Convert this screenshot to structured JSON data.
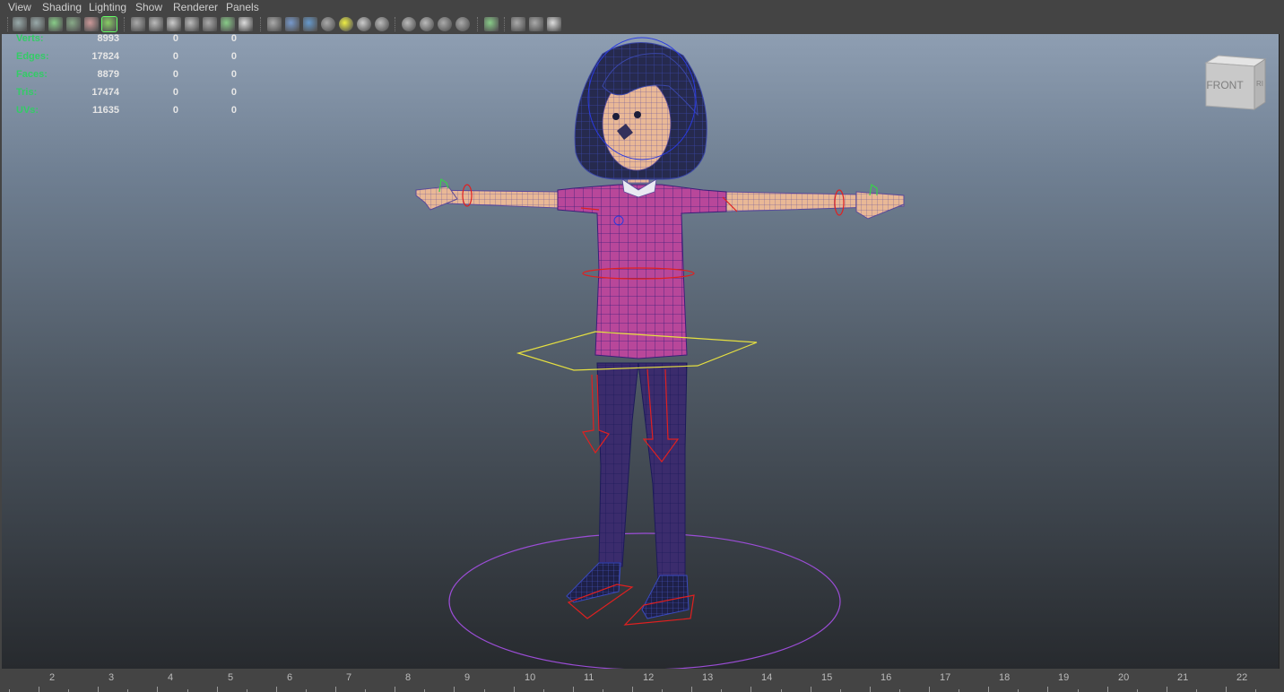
{
  "menu": [
    "View",
    "Shading",
    "Lighting",
    "Show",
    "Renderer",
    "Panels"
  ],
  "toolbar_icons": [
    "select-camera-icon",
    "camera-attributes-icon",
    "bookmarks-icon",
    "image-plane-icon",
    "2d-pan-zoom-icon",
    "grease-pencil-icon",
    "frame-all-icon",
    "grid-icon",
    "film-gate-icon",
    "resolution-gate-icon",
    "gate-mask-icon",
    "field-chart-icon",
    "safe-action-icon",
    "safe-title-icon",
    "wireframe-icon",
    "smooth-shade-icon",
    "wireframe-on-shaded-icon",
    "textured-icon",
    "use-all-lights-icon",
    "shadows-icon",
    "screen-space-ao-icon",
    "motion-blur-icon",
    "multisample-aa-icon",
    "depth-of-field-icon",
    "isolate-select-icon",
    "xray-icon",
    "xray-active-components-icon",
    "xray-joints-icon"
  ],
  "hud": {
    "rows": [
      {
        "label": "Verts:",
        "v1": "8993",
        "v2": "0",
        "v3": "0"
      },
      {
        "label": "Edges:",
        "v1": "17824",
        "v2": "0",
        "v3": "0"
      },
      {
        "label": "Faces:",
        "v1": "8879",
        "v2": "0",
        "v3": "0"
      },
      {
        "label": "Tris:",
        "v1": "17474",
        "v2": "0",
        "v3": "0"
      },
      {
        "label": "UVs:",
        "v1": "11635",
        "v2": "0",
        "v3": "0"
      }
    ]
  },
  "viewcube": {
    "front": "FRONT",
    "side": "RIGHT"
  },
  "timeline": {
    "ticks": [
      "2",
      "3",
      "4",
      "5",
      "6",
      "7",
      "8",
      "9",
      "10",
      "11",
      "12",
      "13",
      "14",
      "15",
      "16",
      "17",
      "18",
      "19",
      "20",
      "21",
      "22"
    ]
  },
  "colors": {
    "hud_label": "#3c6",
    "shirt": "#b0408a",
    "pants": "#3a2c6e",
    "skin": "#e8b898",
    "hair": "#23264a",
    "control_red": "#e02020",
    "control_yellow": "#e6e040",
    "control_purple": "#8a3fd0"
  }
}
